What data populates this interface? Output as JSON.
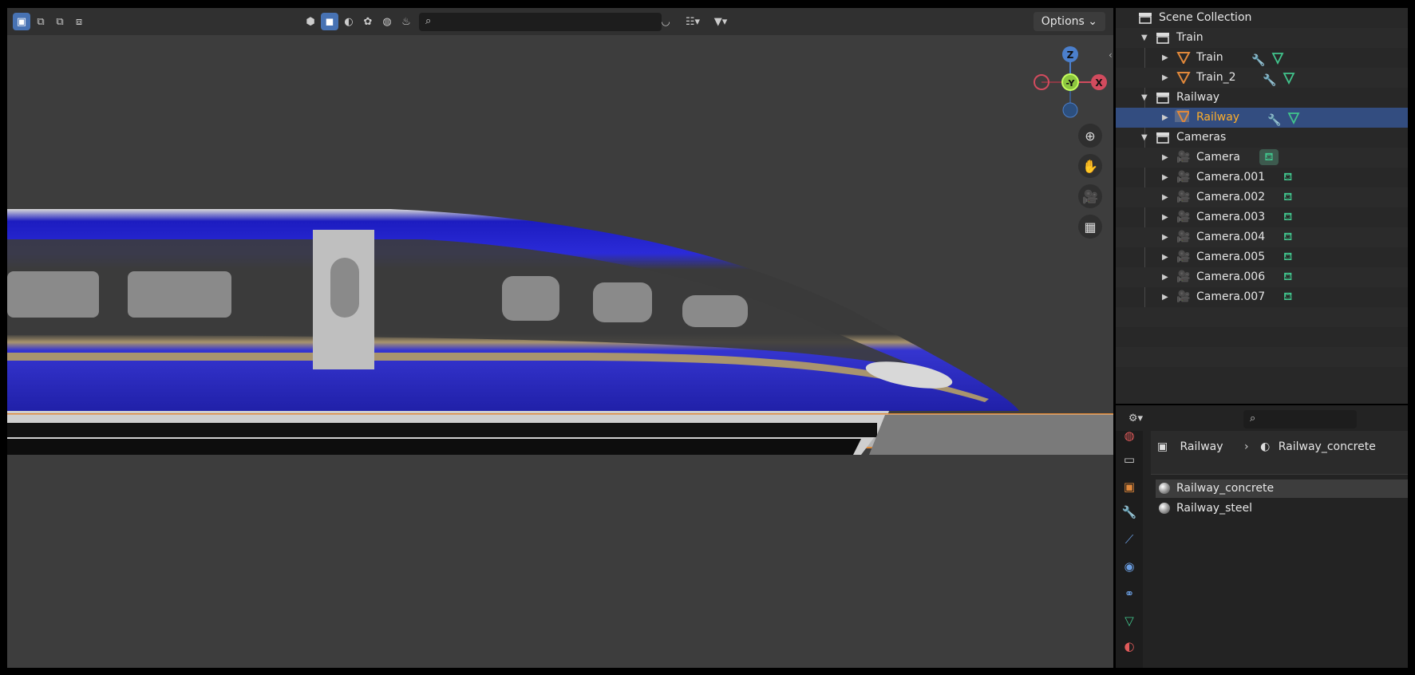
{
  "viewport": {
    "options_label": "Options",
    "search_placeholder": "",
    "gizmo": {
      "z": "Z",
      "y": "-Y",
      "x": "X"
    }
  },
  "outliner": {
    "rows": [
      {
        "label": "Scene Collection",
        "type": "scene"
      },
      {
        "label": "Train",
        "type": "collection"
      },
      {
        "label": "Train",
        "type": "mesh",
        "mods": [
          "wrench",
          "mesh"
        ]
      },
      {
        "label": "Train_2",
        "type": "mesh",
        "mods": [
          "wrench",
          "mesh"
        ]
      },
      {
        "label": "Railway",
        "type": "collection"
      },
      {
        "label": "Railway",
        "type": "mesh",
        "mods": [
          "wrench",
          "mesh"
        ],
        "selected": true
      },
      {
        "label": "Cameras",
        "type": "collection"
      },
      {
        "label": "Camera",
        "type": "camera"
      },
      {
        "label": "Camera.001",
        "type": "camera"
      },
      {
        "label": "Camera.002",
        "type": "camera"
      },
      {
        "label": "Camera.003",
        "type": "camera"
      },
      {
        "label": "Camera.004",
        "type": "camera"
      },
      {
        "label": "Camera.005",
        "type": "camera"
      },
      {
        "label": "Camera.006",
        "type": "camera"
      },
      {
        "label": "Camera.007",
        "type": "camera"
      }
    ]
  },
  "properties": {
    "breadcrumb_object": "Railway",
    "breadcrumb_material": "Railway_concrete",
    "materials": [
      {
        "label": "Railway_concrete",
        "selected": true
      },
      {
        "label": "Railway_steel",
        "selected": false
      }
    ]
  },
  "colors": {
    "accent": "#4772b3",
    "selected_text": "#ffaf29",
    "object_orange": "#e0883b",
    "camera_green": "#41c48c"
  }
}
